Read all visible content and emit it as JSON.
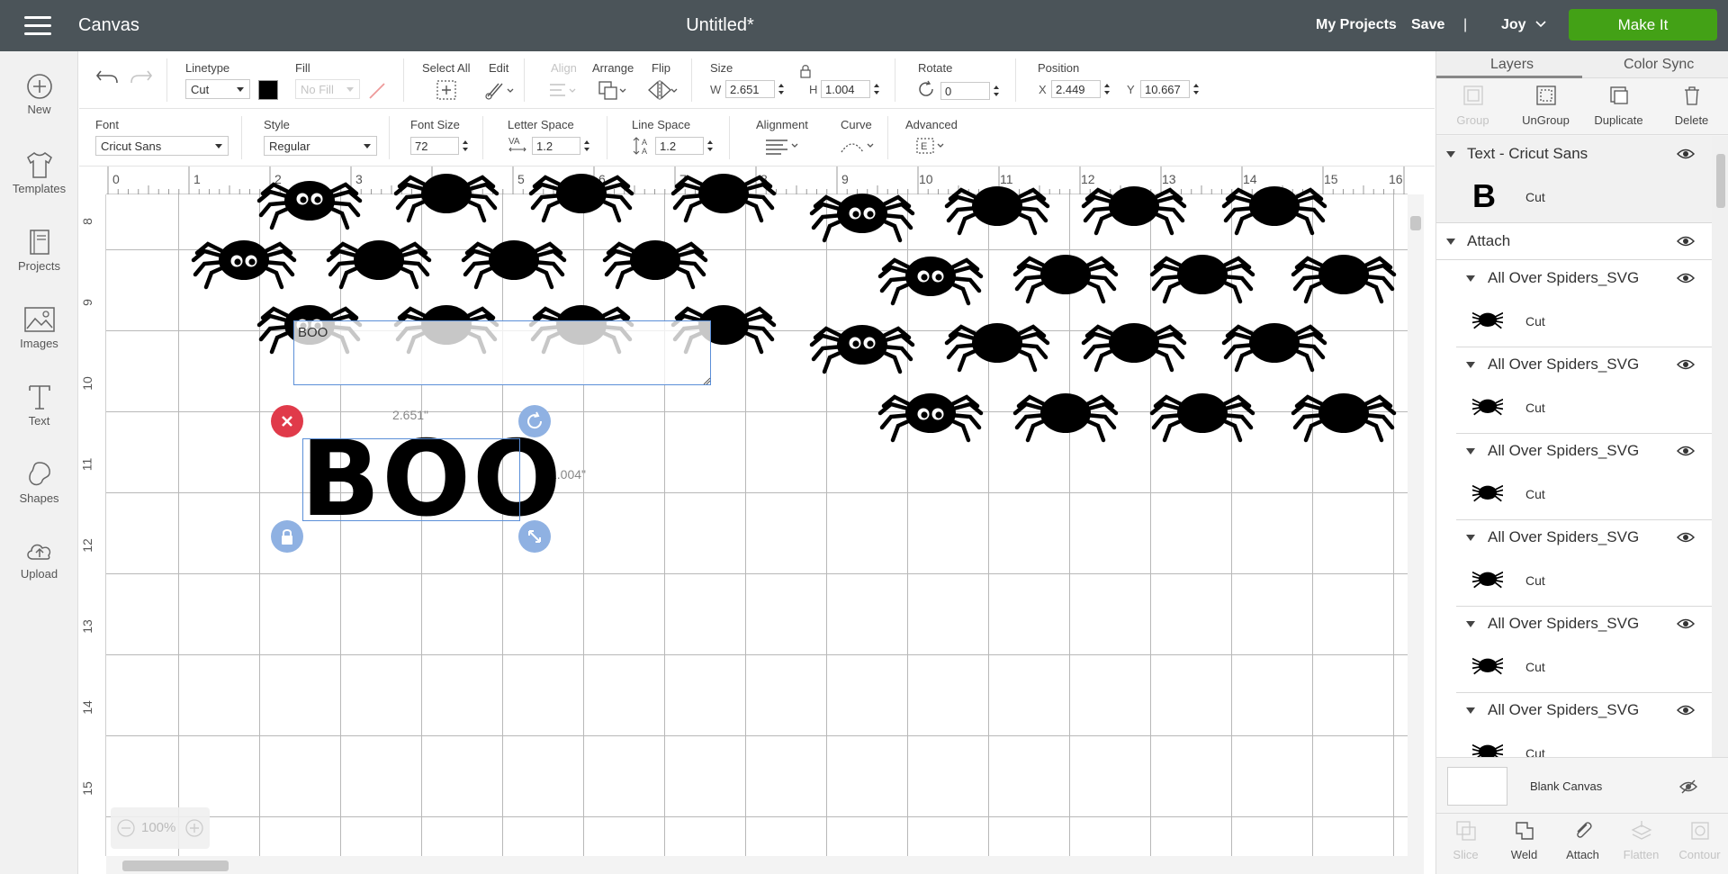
{
  "header": {
    "app_title": "Canvas",
    "doc_title": "Untitled*",
    "my_projects": "My Projects",
    "save": "Save",
    "separator": "|",
    "user": "Joy",
    "make_it": "Make It",
    "make_it_color": "#43a116",
    "bar_color": "#4b5459"
  },
  "sidebar": {
    "items": [
      {
        "label": "New",
        "icon": "plus-circle-icon"
      },
      {
        "label": "Templates",
        "icon": "tshirt-icon"
      },
      {
        "label": "Projects",
        "icon": "book-icon"
      },
      {
        "label": "Images",
        "icon": "image-icon"
      },
      {
        "label": "Text",
        "icon": "text-icon"
      },
      {
        "label": "Shapes",
        "icon": "shapes-icon"
      },
      {
        "label": "Upload",
        "icon": "upload-cloud-icon"
      }
    ]
  },
  "toolbar": {
    "linetype_label": "Linetype",
    "linetype_value": "Cut",
    "fill_label": "Fill",
    "fill_value": "No Fill",
    "select_all_label": "Select All",
    "edit_label": "Edit",
    "align_label": "Align",
    "arrange_label": "Arrange",
    "flip_label": "Flip",
    "size_label": "Size",
    "w_label": "W",
    "w_value": "2.651",
    "h_label": "H",
    "h_value": "1.004",
    "rotate_label": "Rotate",
    "rotate_value": "0",
    "position_label": "Position",
    "x_label": "X",
    "x_value": "2.449",
    "y_label": "Y",
    "y_value": "10.667"
  },
  "text_toolbar": {
    "font_label": "Font",
    "font_value": "Cricut Sans",
    "style_label": "Style",
    "style_value": "Regular",
    "font_size_label": "Font Size",
    "font_size_value": "72",
    "letter_space_label": "Letter Space",
    "letter_space_value": "1.2",
    "line_space_label": "Line Space",
    "line_space_value": "1.2",
    "alignment_label": "Alignment",
    "curve_label": "Curve",
    "advanced_label": "Advanced"
  },
  "canvas": {
    "h_ruler": [
      "0",
      "1",
      "2",
      "3",
      "4",
      "5",
      "6",
      "7",
      "8",
      "9",
      "10",
      "11",
      "12",
      "13",
      "14",
      "15",
      "16"
    ],
    "v_ruler": [
      "8",
      "9",
      "10",
      "11",
      "12",
      "13",
      "14",
      "15"
    ],
    "textbox_value": "BOO",
    "boo_text": "BOO",
    "width_label": "2.651\"",
    "height_label": "1.004\"",
    "zoom": "100%"
  },
  "right_panel": {
    "tab_layers": "Layers",
    "tab_color_sync": "Color Sync",
    "actions": [
      "Group",
      "UnGroup",
      "Duplicate",
      "Delete"
    ],
    "text_layer_title": "Text - Cricut Sans",
    "text_layer_glyph": "B",
    "text_layer_type": "Cut",
    "attach_title": "Attach",
    "groups": [
      {
        "title": "All Over Spiders_SVG",
        "type": "Cut"
      },
      {
        "title": "All Over Spiders_SVG",
        "type": "Cut"
      },
      {
        "title": "All Over Spiders_SVG",
        "type": "Cut"
      },
      {
        "title": "All Over Spiders_SVG",
        "type": "Cut"
      },
      {
        "title": "All Over Spiders_SVG",
        "type": "Cut"
      },
      {
        "title": "All Over Spiders_SVG",
        "type": "Cut"
      }
    ],
    "blank_canvas": "Blank Canvas",
    "bottom_actions": [
      "Slice",
      "Weld",
      "Attach",
      "Flatten",
      "Contour"
    ]
  }
}
